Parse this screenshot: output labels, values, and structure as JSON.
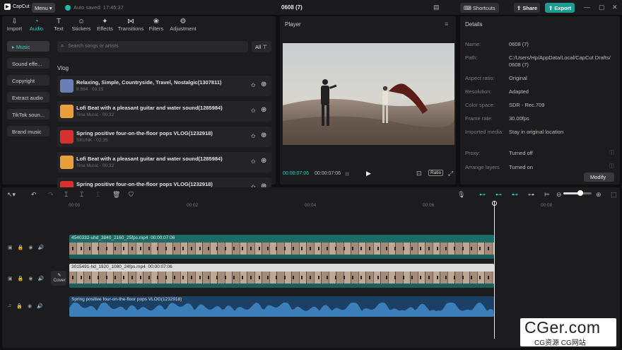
{
  "app": {
    "logo_text": "CapCut",
    "menu_label": "Menu",
    "autosave": "Auto saved: 17:45:37",
    "project_title": "0608 (7)"
  },
  "header": {
    "shortcuts": "Shortcuts",
    "share": "Share",
    "export": "Export"
  },
  "tabs": [
    "Import",
    "Audio",
    "Text",
    "Stickers",
    "Effects",
    "Transitions",
    "Filters",
    "Adjustment"
  ],
  "tab_icons": [
    "import-icon",
    "audio-icon",
    "text-icon",
    "stickers-icon",
    "effects-icon",
    "transitions-icon",
    "filters-icon",
    "adjustment-icon"
  ],
  "active_tab": "Audio",
  "categories": [
    "Music",
    "Sound effe...",
    "Copyright",
    "Extract audio",
    "TikTok soun...",
    "Brand music"
  ],
  "active_category": "Music",
  "search": {
    "placeholder": "Search songs or artists"
  },
  "filter_label": "All",
  "section_label": "Vlog",
  "songs": [
    {
      "title": "Relaxing, Simple, Countryside, Travel, Nostalgic(1307811)",
      "meta": "8.864 · 03:15",
      "color": "#6a7fb8"
    },
    {
      "title": "Lofi Beat with a pleasant guitar and water sound(1285984)",
      "meta": "Tina Music · 00:32",
      "color": "#e9a03a"
    },
    {
      "title": "Spring positive four-on-the-floor pops VLOG(1232918)",
      "meta": "SKUNK · 02:35",
      "color": "#d8302f"
    },
    {
      "title": "Lofi Beat with a pleasant guitar and water sound(1285984)",
      "meta": "Tina Music · 00:32",
      "color": "#e9a03a"
    },
    {
      "title": "Spring positive four-on-the-floor pops VLOG(1232918)",
      "meta": "",
      "color": "#d8302f"
    }
  ],
  "player": {
    "title": "Player",
    "current_time": "00:00:07:06",
    "total_time": "00:00:07:06",
    "ratio_label": "Ratio"
  },
  "details": {
    "title": "Details",
    "rows": [
      {
        "key": "Name:",
        "value": "0608 (7)"
      },
      {
        "key": "Path:",
        "value": "C:/Users/Hp/AppData/Local/CapCut Drafts/ 0608 (7)"
      },
      {
        "key": "Aspect ratio:",
        "value": "Original"
      },
      {
        "key": "Resolution:",
        "value": "Adapted"
      },
      {
        "key": "Color space:",
        "value": "SDR - Rec.709"
      },
      {
        "key": "Frame rate:",
        "value": "30.00fps"
      },
      {
        "key": "Imported media:",
        "value": "Stay in original location"
      },
      {
        "key": "Proxy:",
        "value": "Turned off"
      },
      {
        "key": "Arrange layers",
        "value": "Turned on"
      }
    ],
    "modify_label": "Modify"
  },
  "timeline": {
    "ticks": [
      "00:00",
      "00:02",
      "00:04",
      "00:06",
      "00:08"
    ],
    "clips": [
      {
        "name": "4540332-uhd_3840_2160_25fps.mp4",
        "duration": "00:00:07:06"
      },
      {
        "name": "3015491-hd_1920_1080_24fps.mp4",
        "duration": "00:00:07:06"
      }
    ],
    "audio_clip": "Spring positive four-on-the-floor pops VLOG(1232918)",
    "cover_label": "Cover",
    "zoom_level": 0.6
  },
  "watermark": {
    "big": "CGer.com",
    "small": "CG资源 CG网站"
  }
}
